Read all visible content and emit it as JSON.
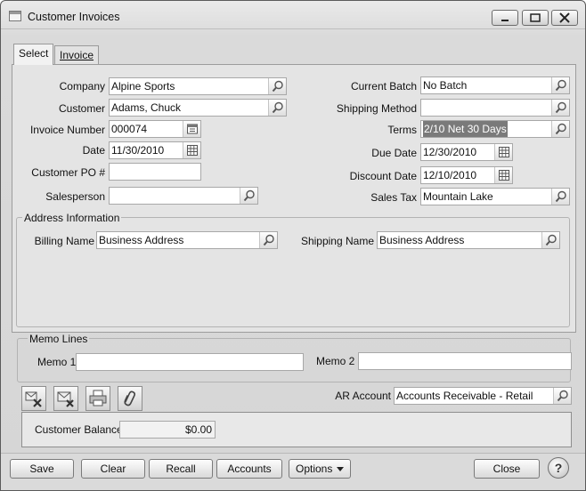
{
  "window": {
    "title": "Customer Invoices",
    "minimize": "_",
    "maximize": "□",
    "close": "X"
  },
  "tabs": [
    {
      "label": "Select"
    },
    {
      "label": "Invoice"
    }
  ],
  "form": {
    "company": {
      "label": "Company",
      "value": "Alpine Sports"
    },
    "customer": {
      "label": "Customer",
      "value": "Adams, Chuck"
    },
    "invoice_number": {
      "label": "Invoice Number",
      "value": "000074"
    },
    "date": {
      "label": "Date",
      "value": "11/30/2010"
    },
    "customer_po": {
      "label": "Customer PO #",
      "value": ""
    },
    "salesperson": {
      "label": "Salesperson",
      "value": ""
    },
    "current_batch": {
      "label": "Current Batch",
      "value": "No Batch"
    },
    "shipping_method": {
      "label": "Shipping Method",
      "value": ""
    },
    "terms": {
      "label": "Terms",
      "value": "2/10 Net 30 Days"
    },
    "due_date": {
      "label": "Due Date",
      "value": "12/30/2010"
    },
    "discount_date": {
      "label": "Discount Date",
      "value": "12/10/2010"
    },
    "sales_tax": {
      "label": "Sales Tax",
      "value": "Mountain Lake"
    }
  },
  "address": {
    "title": "Address Information",
    "billing": {
      "label": "Billing Name",
      "value": "Business Address"
    },
    "shipping": {
      "label": "Shipping Name",
      "value": "Business Address"
    }
  },
  "memo": {
    "title": "Memo Lines",
    "memo1": {
      "label": "Memo 1",
      "value": ""
    },
    "memo2": {
      "label": "Memo 2",
      "value": ""
    }
  },
  "ar_account": {
    "label": "AR Account",
    "value": "Accounts Receivable - Retail"
  },
  "balance": {
    "label": "Customer Balance",
    "value": "$0.00"
  },
  "buttons": {
    "save": "Save",
    "clear": "Clear",
    "recall": "Recall",
    "accounts": "Accounts",
    "options": "Options",
    "close": "Close",
    "help": "?"
  },
  "icons": {
    "lookup": "magnifier-icon",
    "calendar": "calendar-icon",
    "number_pad": "number-generator-icon"
  }
}
